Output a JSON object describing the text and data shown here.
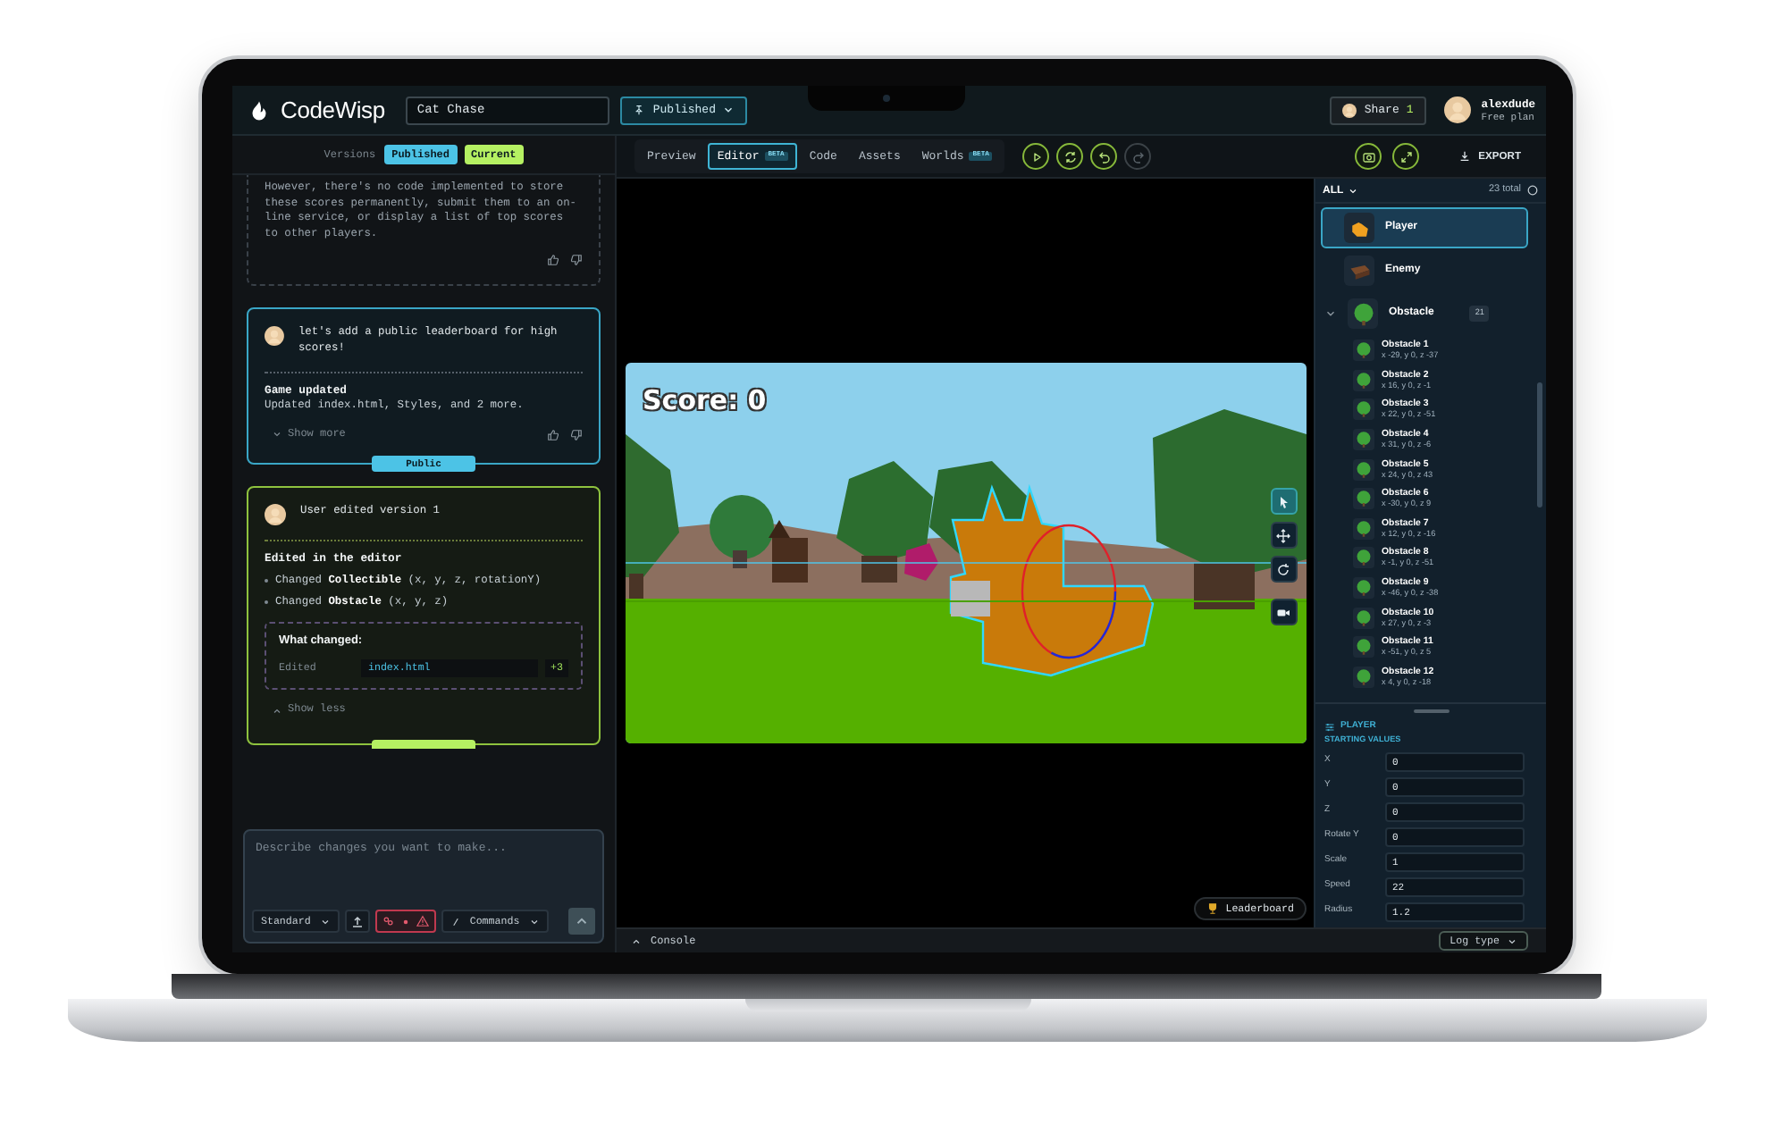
{
  "app": {
    "name": "CodeWisp"
  },
  "project_field": {
    "value": "Cat Chase"
  },
  "publish_menu": {
    "label": "Published"
  },
  "share": {
    "label": "Share",
    "count": "1"
  },
  "user": {
    "name": "alexdude",
    "plan": "Free plan"
  },
  "versions_bar": {
    "label": "Versions",
    "badges": [
      {
        "label": "Published",
        "kind": "published"
      },
      {
        "label": "Current",
        "kind": "current"
      }
    ]
  },
  "messages": [
    {
      "kind": "assistant",
      "text": "However, there's no code implemented to store these scores permanently, submit them to an on-line service, or display a list of top scores to other players."
    },
    {
      "kind": "prompt",
      "text": "let's add a public leaderboard for high scores!",
      "result_title": "Game updated",
      "result_text": "Updated index.html, Styles, and 2 more.",
      "toggle": "Show more",
      "expanded": false,
      "badge": "Public"
    },
    {
      "kind": "edit",
      "text": "User edited version 1",
      "result_title": "Edited in the editor",
      "changes": [
        "Changed **Collectible** (x, y, z, rotationY)",
        "Changed **Obstacle** (x, y, z)"
      ],
      "diff": {
        "title": "What changed:",
        "rows": [
          {
            "action": "Edited",
            "file": "index.html",
            "delta": "+3"
          }
        ]
      },
      "toggle": "Show less",
      "expanded": true
    }
  ],
  "composer": {
    "placeholder": "Describe changes you want to make...",
    "mode": "Standard",
    "commands": "Commands"
  },
  "editor_tabs": [
    {
      "label": "Preview",
      "selected": false
    },
    {
      "label": "Editor",
      "badge": "BETA",
      "selected": true
    },
    {
      "label": "Code",
      "selected": false
    },
    {
      "label": "Assets",
      "selected": false
    },
    {
      "label": "Worlds",
      "badge": "BETA",
      "selected": false
    }
  ],
  "playback_controls": [
    {
      "kind": "play",
      "disabled": false
    },
    {
      "kind": "sync",
      "disabled": false
    },
    {
      "kind": "undo",
      "disabled": false
    },
    {
      "kind": "redo",
      "disabled": true
    }
  ],
  "export_button": {
    "label": "EXPORT"
  },
  "game": {
    "score_text": "Score: 0",
    "tools": [
      {
        "kind": "select",
        "selected": true
      },
      {
        "kind": "move",
        "selected": false
      },
      {
        "kind": "rotate",
        "selected": false
      },
      {
        "kind": "camera",
        "selected": false
      }
    ]
  },
  "leaderboard_button": {
    "label": "Leaderboard"
  },
  "console": {
    "label": "Console",
    "expanded": false,
    "log_type": "Log type"
  },
  "objects": {
    "filter": "ALL",
    "total": "23 total",
    "items": [
      {
        "name": "Player",
        "kind": "player",
        "selected": true
      },
      {
        "name": "Enemy",
        "kind": "enemy",
        "selected": false
      },
      {
        "name": "Obstacle",
        "kind": "obstacle",
        "count": "21",
        "expanded": true,
        "selected": false,
        "children": [
          {
            "name": "Obstacle 1",
            "position": "x -29, y 0, z -37",
            "selected": false
          },
          {
            "name": "Obstacle 2",
            "position": "x 16, y 0, z -1",
            "selected": false
          },
          {
            "name": "Obstacle 3",
            "position": "x 22, y 0, z -51",
            "selected": false
          },
          {
            "name": "Obstacle 4",
            "position": "x 31, y 0, z -6",
            "selected": false
          },
          {
            "name": "Obstacle 5",
            "position": "x 24, y 0, z 43",
            "selected": false
          },
          {
            "name": "Obstacle 6",
            "position": "x -30, y 0, z 9",
            "selected": false
          },
          {
            "name": "Obstacle 7",
            "position": "x 12, y 0, z -16",
            "selected": false
          },
          {
            "name": "Obstacle 8",
            "position": "x -1, y 0, z -51",
            "selected": false
          },
          {
            "name": "Obstacle 9",
            "position": "x -46, y 0, z -38",
            "selected": false
          },
          {
            "name": "Obstacle 10",
            "position": "x 27, y 0, z -3",
            "selected": false
          },
          {
            "name": "Obstacle 11",
            "position": "x -51, y 0, z 5",
            "selected": false
          },
          {
            "name": "Obstacle 12",
            "position": "x 4, y 0, z -18",
            "selected": false
          }
        ]
      }
    ]
  },
  "inspector": {
    "title": "PLAYER",
    "section": "STARTING VALUES",
    "fields": [
      {
        "label": "X",
        "value": "0"
      },
      {
        "label": "Y",
        "value": "0"
      },
      {
        "label": "Z",
        "value": "0"
      },
      {
        "label": "Rotate Y",
        "value": "0"
      },
      {
        "label": "Scale",
        "value": "1"
      },
      {
        "label": "Speed",
        "value": "22"
      },
      {
        "label": "Radius",
        "value": "1.2"
      }
    ]
  }
}
